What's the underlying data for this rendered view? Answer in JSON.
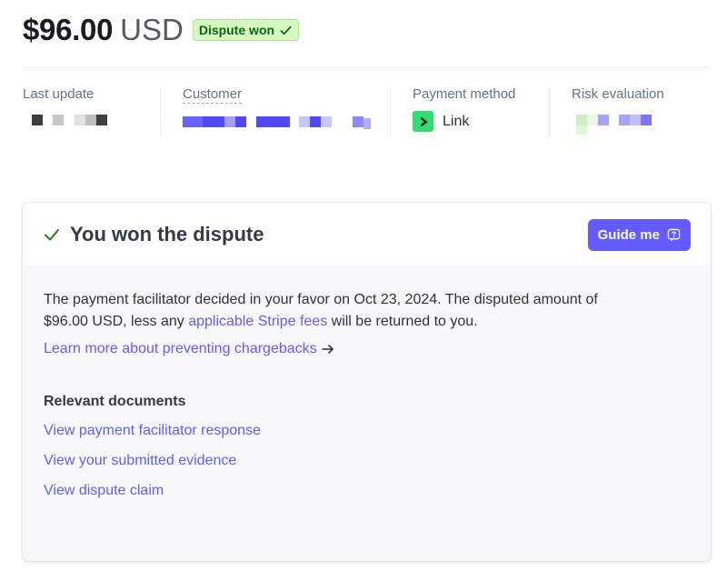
{
  "header": {
    "amount": "$96.00",
    "currency": "USD",
    "badge": "Dispute won"
  },
  "summary": {
    "last_update_label": "Last update",
    "customer_label": "Customer",
    "payment_method_label": "Payment method",
    "payment_method_value": "Link",
    "risk_label": "Risk evaluation"
  },
  "card": {
    "title": "You won the dispute",
    "guide_button": "Guide me",
    "para_part1": "The payment facilitator decided in your favor on Oct 23, 2024. The disputed amount of $96.00 USD, less any ",
    "para_link": "applicable Stripe fees",
    "para_part2": " will be returned to you.",
    "learn_more": "Learn more about preventing chargebacks",
    "docs_title": "Relevant documents",
    "docs": [
      "View payment facilitator response",
      "View your submitted evidence",
      "View dispute claim"
    ]
  },
  "colors": {
    "accent": "#635bff",
    "success_bg": "#d7f7c2",
    "success_text": "#05690d",
    "link_brand": "#33dd72"
  },
  "icons": {
    "badge": "check-icon",
    "title": "check-icon",
    "guide": "help-icon",
    "learn": "arrow-right-icon",
    "payment": "link-logo-icon"
  }
}
